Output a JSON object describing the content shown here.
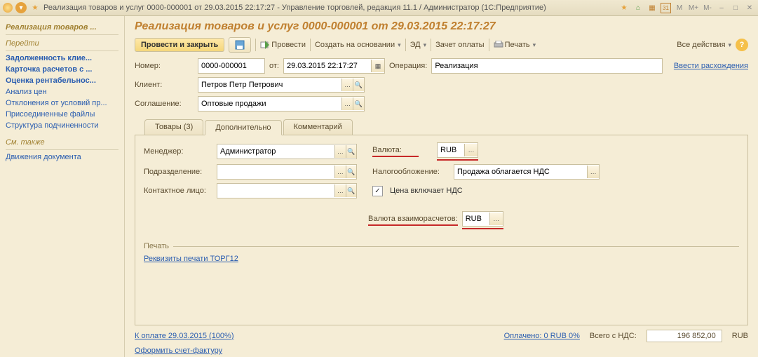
{
  "titlebar": {
    "text": "Реализация товаров и услуг 0000-000001 от 29.03.2015 22:17:27 - Управление торговлей, редакция 11.1 / Администратор  (1С:Предприятие)",
    "buttons": [
      "M",
      "M+",
      "M-"
    ]
  },
  "sidebar": {
    "main_title": "Реализация товаров ...",
    "nav_title": "Перейти",
    "nav_items": [
      {
        "label": "Задолженность клие...",
        "bold": true
      },
      {
        "label": "Карточка расчетов с ...",
        "bold": true
      },
      {
        "label": "Оценка рентабельнос...",
        "bold": true
      },
      {
        "label": "Анализ цен",
        "bold": false
      },
      {
        "label": "Отклонения от условий пр...",
        "bold": false
      },
      {
        "label": "Присоединенные файлы",
        "bold": false
      },
      {
        "label": "Структура подчиненности",
        "bold": false
      }
    ],
    "see_title": "См. также",
    "see_items": [
      {
        "label": "Движения документа"
      }
    ]
  },
  "header_title": "Реализация товаров и услуг 0000-000001 от 29.03.2015 22:17:27",
  "toolbar": {
    "post_close": "Провести и закрыть",
    "post": "Провести",
    "create_based": "Создать на основании",
    "ed": "ЭД",
    "offset": "Зачет оплаты",
    "print": "Печать",
    "all_actions": "Все действия"
  },
  "fields": {
    "number_label": "Номер:",
    "number": "0000-000001",
    "from_label": "от:",
    "date": "29.03.2015 22:17:27",
    "operation_label": "Операция:",
    "operation": "Реализация",
    "discrepancy": "Ввести расхождения",
    "client_label": "Клиент:",
    "client": "Петров Петр Петрович",
    "agreement_label": "Соглашение:",
    "agreement": "Оптовые продажи"
  },
  "tabs": {
    "goods": "Товары (3)",
    "more": "Дополнительно",
    "comment": "Комментарий"
  },
  "more": {
    "manager_label": "Менеджер:",
    "manager": "Администратор",
    "currency_label": "Валюта:",
    "currency": "RUB",
    "department_label": "Подразделение:",
    "department": "",
    "tax_label": "Налогообложение:",
    "tax": "Продажа облагается НДС",
    "contact_label": "Контактное лицо:",
    "contact": "",
    "price_includes_vat": "Цена включает НДС",
    "settlement_currency_label": "Валюта взаиморасчетов:",
    "settlement_currency": "RUB",
    "print_section": "Печать",
    "torg12": "Реквизиты печати ТОРГ12"
  },
  "footer": {
    "to_pay": "К оплате 29.03.2015 (100%)",
    "paid": "Оплачено: 0 RUB  0%",
    "total_label": "Всего с НДС:",
    "total": "196 852,00",
    "cur": "RUB",
    "invoice": "Оформить счет-фактуру"
  }
}
